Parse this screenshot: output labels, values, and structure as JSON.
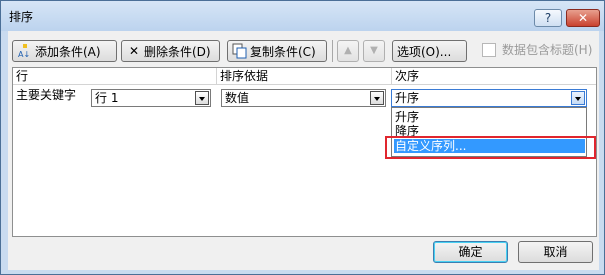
{
  "window": {
    "title": "排序",
    "help_label": "?",
    "close_label": "✕"
  },
  "toolbar": {
    "add_condition": "添加条件(A)",
    "delete_condition": "删除条件(D)",
    "copy_condition": "复制条件(C)",
    "move_up": "▲",
    "move_down": "▼",
    "options": "选项(O)...",
    "header_checkbox_label": "数据包含标题(H)",
    "header_checkbox_checked": false
  },
  "grid": {
    "headers": {
      "column": "行",
      "sort_on": "排序依据",
      "order": "次序"
    },
    "row": {
      "label": "主要关键字",
      "key": "行 1",
      "sort_on": "数值",
      "order": "升序"
    }
  },
  "order_dropdown": {
    "options": [
      "升序",
      "降序",
      "自定义序列..."
    ],
    "highlighted_index": 2
  },
  "footer": {
    "ok": "确定",
    "cancel": "取消"
  },
  "colors": {
    "highlight": "#3399ff",
    "annotation_red": "#e0262e",
    "frame": "#c9dbf0"
  }
}
